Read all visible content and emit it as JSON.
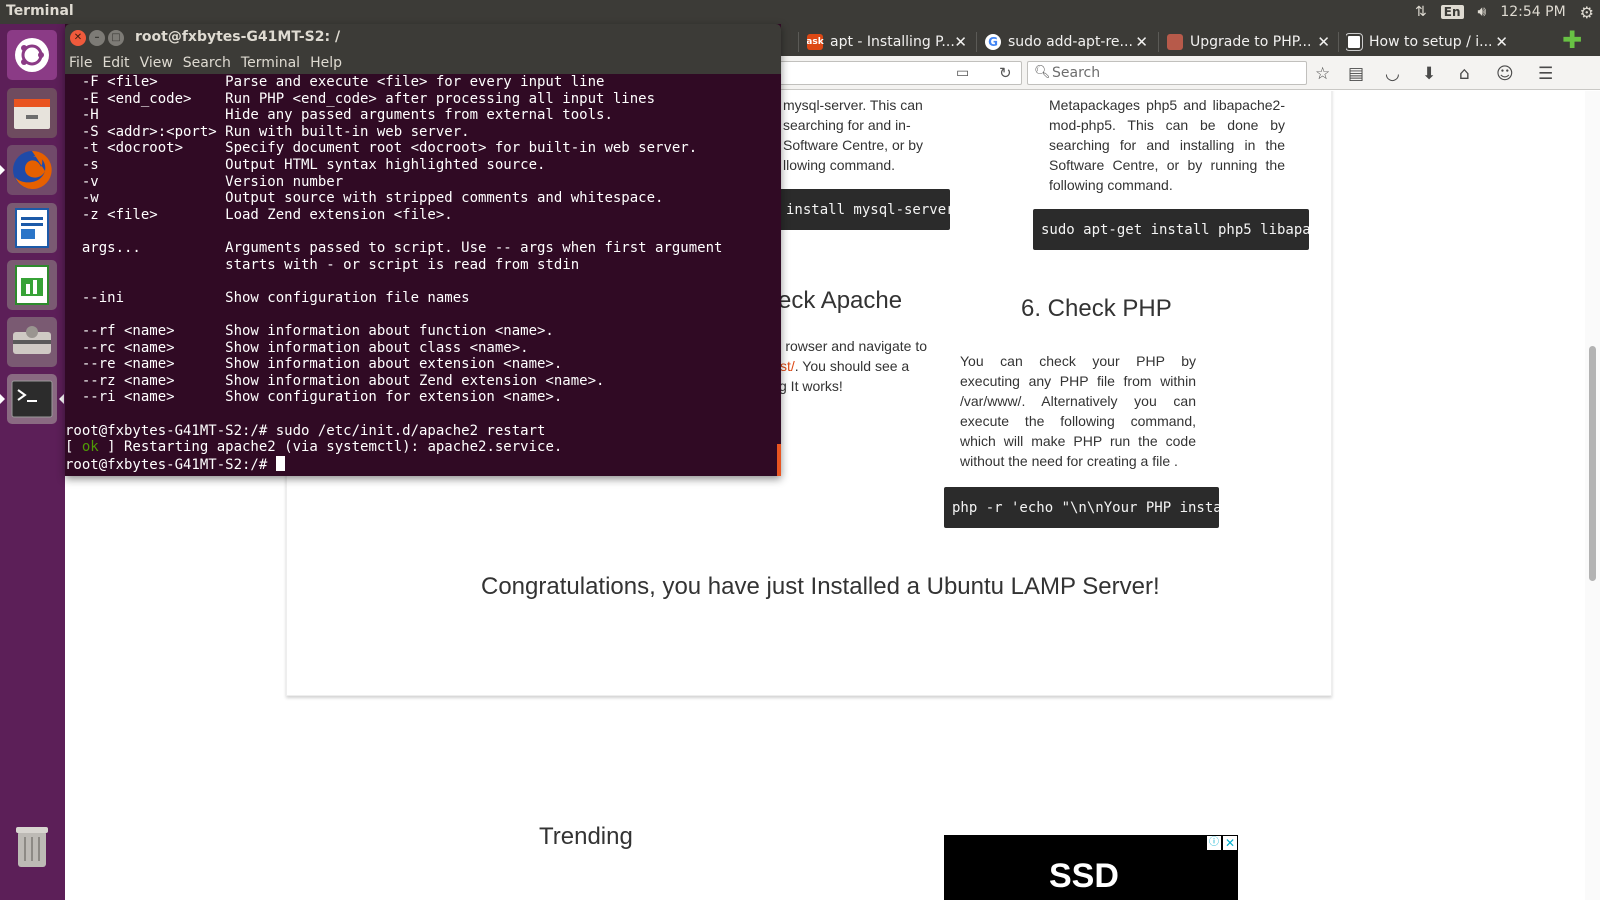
{
  "top_panel": {
    "app_name": "Terminal",
    "keyboard_layout": "En",
    "clock": "12:54 PM"
  },
  "launcher": {
    "items": [
      "dash-home",
      "files",
      "firefox",
      "libreoffice-writer",
      "libreoffice-calc",
      "system-settings",
      "terminal",
      "trash"
    ]
  },
  "terminal": {
    "title": "root@fxbytes-G41MT-S2: /",
    "menu": [
      "File",
      "Edit",
      "View",
      "Search",
      "Terminal",
      "Help"
    ],
    "lines": [
      "  -F <file>        Parse and execute <file> for every input line",
      "  -E <end_code>    Run PHP <end_code> after processing all input lines",
      "  -H               Hide any passed arguments from external tools.",
      "  -S <addr>:<port> Run with built-in web server.",
      "  -t <docroot>     Specify document root <docroot> for built-in web server.",
      "  -s               Output HTML syntax highlighted source.",
      "  -v               Version number",
      "  -w               Output source with stripped comments and whitespace.",
      "  -z <file>        Load Zend extension <file>.",
      "",
      "  args...          Arguments passed to script. Use -- args when first argument",
      "                   starts with - or script is read from stdin",
      "",
      "  --ini            Show configuration file names",
      "",
      "  --rf <name>      Show information about function <name>.",
      "  --rc <name>      Show information about class <name>.",
      "  --re <name>      Show information about extension <name>.",
      "  --rz <name>      Show information about Zend extension <name>.",
      "  --ri <name>      Show configuration for extension <name>.",
      "",
      "root@fxbytes-G41MT-S2:/# sudo /etc/init.d/apache2 restart"
    ],
    "status_open": "[ ",
    "status_ok": "ok",
    "status_rest": " ] Restarting apache2 (via systemctl): apache2.service.",
    "prompt": "root@fxbytes-G41MT-S2:/# "
  },
  "browser": {
    "tabs": [
      {
        "label": "apt - Installing P...",
        "favicon": "askubuntu-icon",
        "favicon_text": "ask"
      },
      {
        "label": "sudo add-apt-re...",
        "favicon": "google-icon",
        "favicon_text": "G"
      },
      {
        "label": "Upgrade to PHP...",
        "favicon": "page-icon",
        "favicon_text": ""
      },
      {
        "label": "How to setup / i...",
        "favicon": "page-icon",
        "favicon_text": ""
      }
    ],
    "search_placeholder": "Search"
  },
  "page": {
    "left_para": "mysql-server. This can\nsearching for and in-\nSoftware Centre, or by\nllowing command.",
    "left_cmd": "install mysql-server",
    "right_para": "Metapackages php5 and libapache2-mod-php5. This can be done by searching for and installing in the Software Centre, or by running the following command.",
    "right_cmd": "sudo apt-get install php5 libapac",
    "check_apache_heading": "eck Apache",
    "check_apache_line1": "rowser and navigate to",
    "check_apache_link": "st/",
    "check_apache_line2_rest": ". You should see a",
    "check_apache_line3": "g It works!",
    "check_php_heading": "6. Check PHP",
    "check_php_para": "You can check your PHP by executing any PHP file from within /var/www/. Alternatively you can execute the following command, which will make PHP run the code without the need for creating a file .",
    "php_cmd": "php -r 'echo \"\\n\\nYour PHP instal",
    "congrats": "Congratulations, you have just Installed a Ubuntu LAMP Server!",
    "trending": "Trending",
    "ad_text": "SSD"
  },
  "colors": {
    "launcher_bg": "#5c1f58",
    "panel_bg": "#3c3b37",
    "terminal_bg": "#300a24",
    "link": "#dd4814",
    "close_button": "#ef5a3c"
  }
}
